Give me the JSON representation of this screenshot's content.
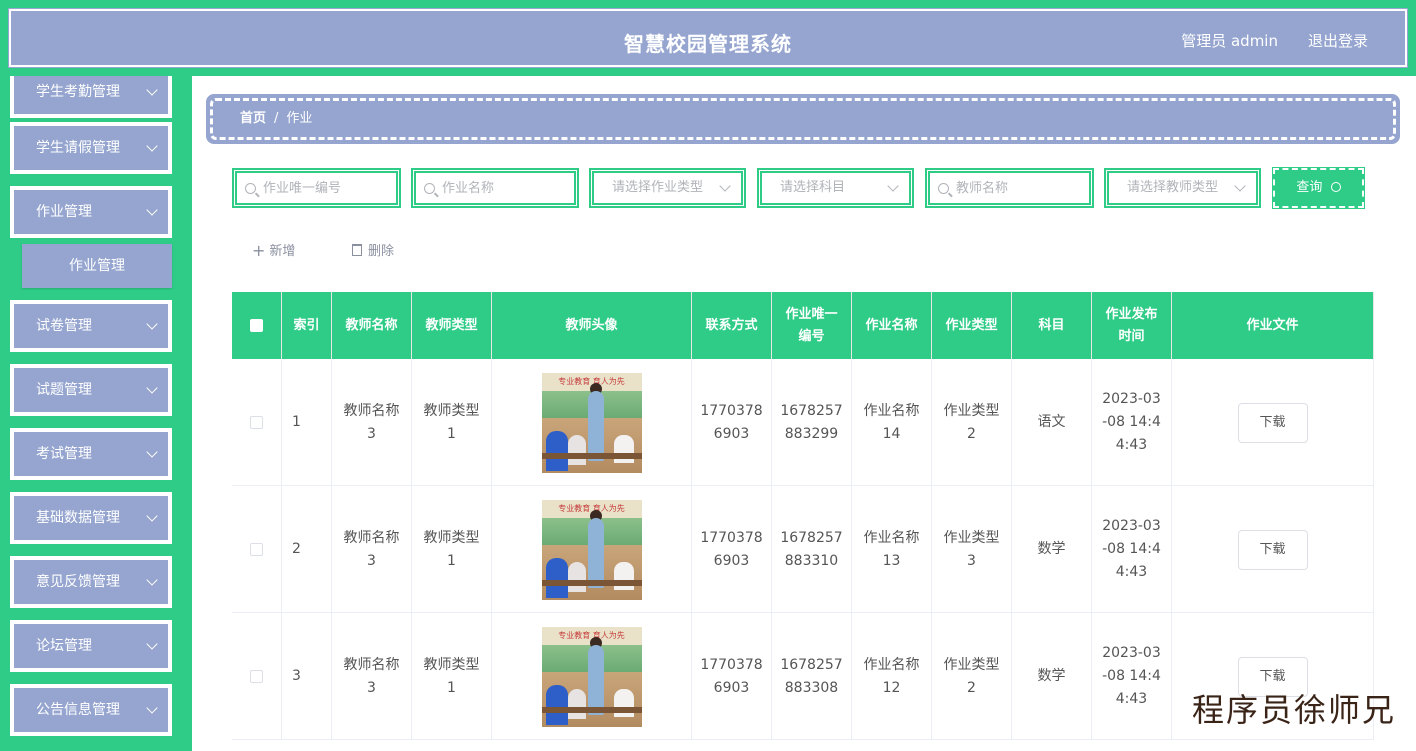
{
  "header": {
    "title": "智慧校园管理系统",
    "user": "管理员 admin",
    "logout": "退出登录"
  },
  "sidebar": {
    "items": [
      {
        "label": "学生考勤管理"
      },
      {
        "label": "学生请假管理"
      },
      {
        "label": "作业管理"
      },
      {
        "label": "试卷管理"
      },
      {
        "label": "试题管理"
      },
      {
        "label": "考试管理"
      },
      {
        "label": "基础数据管理"
      },
      {
        "label": "意见反馈管理"
      },
      {
        "label": "论坛管理"
      },
      {
        "label": "公告信息管理"
      }
    ],
    "submenu": {
      "label": "作业管理"
    }
  },
  "breadcrumb": {
    "home": "首页",
    "separator": "/",
    "current": "作业"
  },
  "search": {
    "code_placeholder": "作业唯一编号",
    "name_placeholder": "作业名称",
    "type_select": "请选择作业类型",
    "subject_select": "请选择科目",
    "teacher_placeholder": "教师名称",
    "teacher_type_select": "请选择教师类型",
    "query_label": "查询"
  },
  "actions": {
    "add_label": "新增",
    "delete_label": "删除"
  },
  "table": {
    "headers": [
      "索引",
      "教师名称",
      "教师类型",
      "教师头像",
      "联系方式",
      "作业唯一\n编号",
      "作业名称",
      "作业类型",
      "科目",
      "作业发布\n时间",
      "作业文件"
    ],
    "rows": [
      {
        "index": "1",
        "teacher_name": "教师名称\n3",
        "teacher_type": "教师类型\n1",
        "phone": "1770378\n6903",
        "code": "1678257\n883299",
        "hw_name": "作业名称\n14",
        "hw_type": "作业类型\n2",
        "subject": "语文",
        "time": "2023-03\n-08 14:4\n4:43",
        "download": "下载"
      },
      {
        "index": "2",
        "teacher_name": "教师名称\n3",
        "teacher_type": "教师类型\n1",
        "phone": "1770378\n6903",
        "code": "1678257\n883310",
        "hw_name": "作业名称\n13",
        "hw_type": "作业类型\n3",
        "subject": "数学",
        "time": "2023-03\n-08 14:4\n4:43",
        "download": "下载"
      },
      {
        "index": "3",
        "teacher_name": "教师名称\n3",
        "teacher_type": "教师类型\n1",
        "phone": "1770378\n6903",
        "code": "1678257\n883308",
        "hw_name": "作业名称\n12",
        "hw_type": "作业类型\n2",
        "subject": "数学",
        "time": "2023-03\n-08 14:4\n4:43",
        "download": "下载"
      }
    ],
    "avatar_banner": "专业教育 育人为先"
  },
  "watermark": "程序员徐师兄",
  "colors": {
    "accent": "#2ecc87",
    "header_bg": "#95a5cf"
  }
}
